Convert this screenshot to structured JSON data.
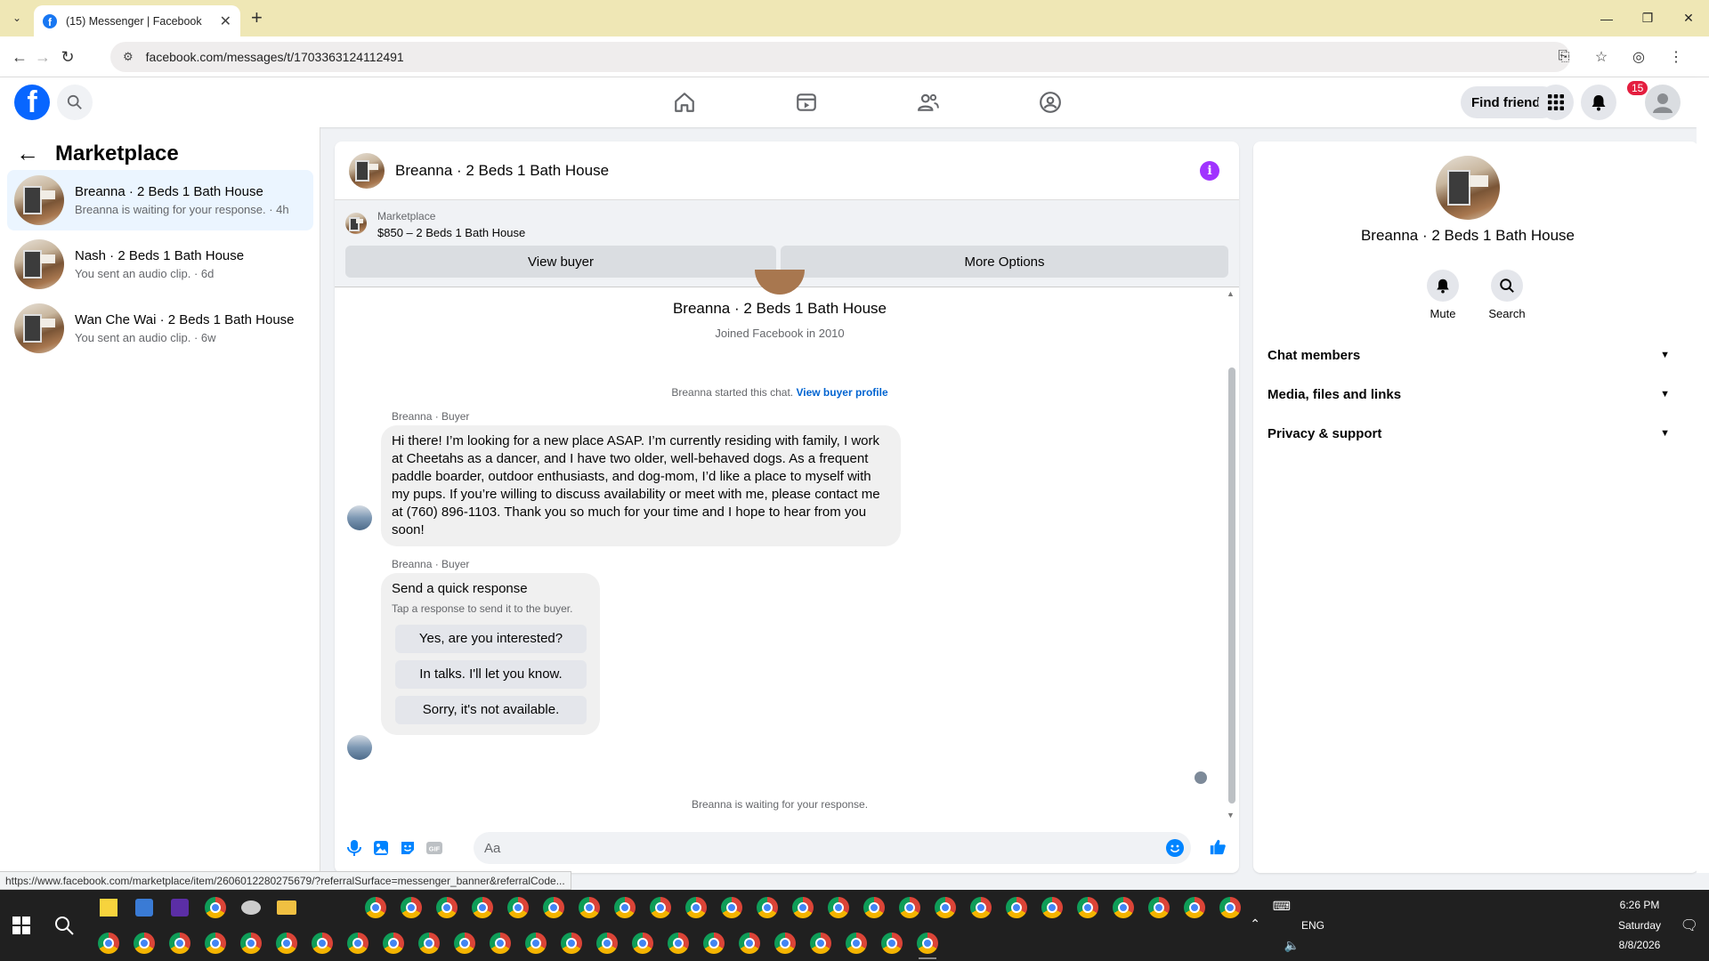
{
  "browser": {
    "tab_title": "(15) Messenger | Facebook",
    "url": "facebook.com/messages/t/1703363124112491",
    "status_url": "https://www.facebook.com/marketplace/item/2606012280275679/?referralSurface=messenger_banner&referralCode..."
  },
  "header": {
    "find_friends": "Find friends",
    "notification_count": "15"
  },
  "sidebar": {
    "title": "Marketplace",
    "chats": [
      {
        "name": "Breanna · 2 Beds 1 Bath House",
        "preview": "Breanna is waiting for your response. · 4h"
      },
      {
        "name": "Nash · 2 Beds 1 Bath House",
        "preview": "You sent an audio clip. · 6d"
      },
      {
        "name": "Wan Che Wai · 2 Beds 1 Bath House",
        "preview": "You sent an audio clip. · 6w"
      }
    ]
  },
  "conversation": {
    "title": "Breanna · 2 Beds 1 Bath House",
    "banner": {
      "label": "Marketplace",
      "listing": "$850 – 2 Beds 1 Bath House",
      "view_buyer": "View buyer",
      "more_options": "More Options"
    },
    "profile_name": "Breanna · 2 Beds 1 Bath House",
    "joined": "Joined Facebook in 2010",
    "started_text": "Breanna started this chat.",
    "view_buyer_profile": "View buyer profile",
    "sender_label": "Breanna · Buyer",
    "message_lines": [
      "Hi there! I’m looking for a new place ASAP. I’m currently residing with family, I work",
      "at Cheetahs as a dancer, and I have two older, well-behaved dogs. As a frequent",
      "paddle boarder, outdoor enthusiasts, and dog-mom, I’d like a place to myself with",
      "my pups. If you’re willing to discuss availability or meet with me, please contact me",
      "at (760) 896-1103. Thank you so much for your time and I hope to hear from you",
      "soon!"
    ],
    "quick_response": {
      "title": "Send a quick response",
      "subtitle": "Tap a response to send it to the buyer.",
      "options": [
        "Yes, are you interested?",
        "In talks. I'll let you know.",
        "Sorry, it's not available."
      ]
    },
    "waiting": "Breanna is waiting for your response.",
    "composer_placeholder": "Aa"
  },
  "info_panel": {
    "name": "Breanna · 2 Beds 1 Bath House",
    "actions": [
      "Mute",
      "Search"
    ],
    "sections": [
      "Chat members",
      "Media, files and links",
      "Privacy & support"
    ]
  },
  "taskbar": {
    "time": "6:26 PM",
    "day": "Saturday",
    "date": "8/8/2026",
    "lang": "ENG"
  },
  "colors": {
    "facebook_blue": "#0866ff",
    "messenger_purple": "#a033ff",
    "active_chat_bg": "#ebf5ff",
    "notification_red": "#e41e3f"
  }
}
